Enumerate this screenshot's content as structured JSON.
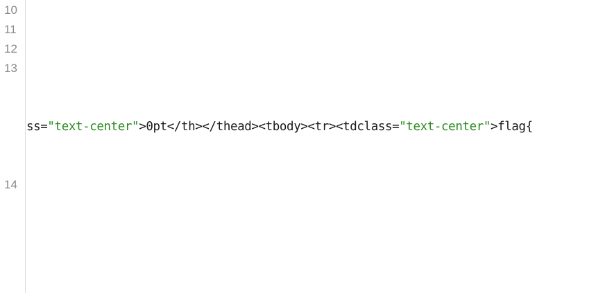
{
  "gutter": {
    "line_numbers": [
      "10",
      "11",
      "12",
      "13",
      "14"
    ]
  },
  "code": {
    "segments": [
      {
        "text": "ss=",
        "kind": "plain"
      },
      {
        "text": "\"text-center\"",
        "kind": "string"
      },
      {
        "text": ">0pt</th></thead><tbody><tr><tdclass=",
        "kind": "plain"
      },
      {
        "text": "\"text-center\"",
        "kind": "string"
      },
      {
        "text": ">flag{",
        "kind": "plain"
      }
    ]
  },
  "colors": {
    "string": "#2a8a1f",
    "plain": "#1a1a1a",
    "line_number": "#8a8a8a",
    "gutter_border": "#dcdcdc"
  }
}
